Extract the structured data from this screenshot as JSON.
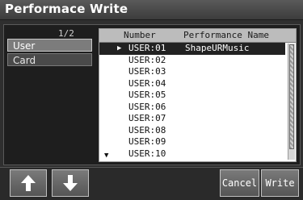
{
  "window": {
    "title": "Performace Write"
  },
  "pager": {
    "text": "1/2"
  },
  "side_tabs": [
    {
      "label": "User"
    },
    {
      "label": "Card"
    }
  ],
  "list": {
    "columns": [
      "Number",
      "Performance Name"
    ],
    "rows": [
      {
        "number": "USER:01",
        "name": "ShapeURMusic",
        "selected": true
      },
      {
        "number": "USER:02",
        "name": ""
      },
      {
        "number": "USER:03",
        "name": ""
      },
      {
        "number": "USER:04",
        "name": ""
      },
      {
        "number": "USER:05",
        "name": ""
      },
      {
        "number": "USER:06",
        "name": ""
      },
      {
        "number": "USER:07",
        "name": ""
      },
      {
        "number": "USER:08",
        "name": ""
      },
      {
        "number": "USER:09",
        "name": ""
      },
      {
        "number": "USER:10",
        "name": ""
      }
    ],
    "selected_marker": "▶",
    "more_marker": "▼"
  },
  "buttons": {
    "up_icon": "up-arrow-icon",
    "down_icon": "down-arrow-icon",
    "cancel": "Cancel",
    "write": "Write"
  }
}
